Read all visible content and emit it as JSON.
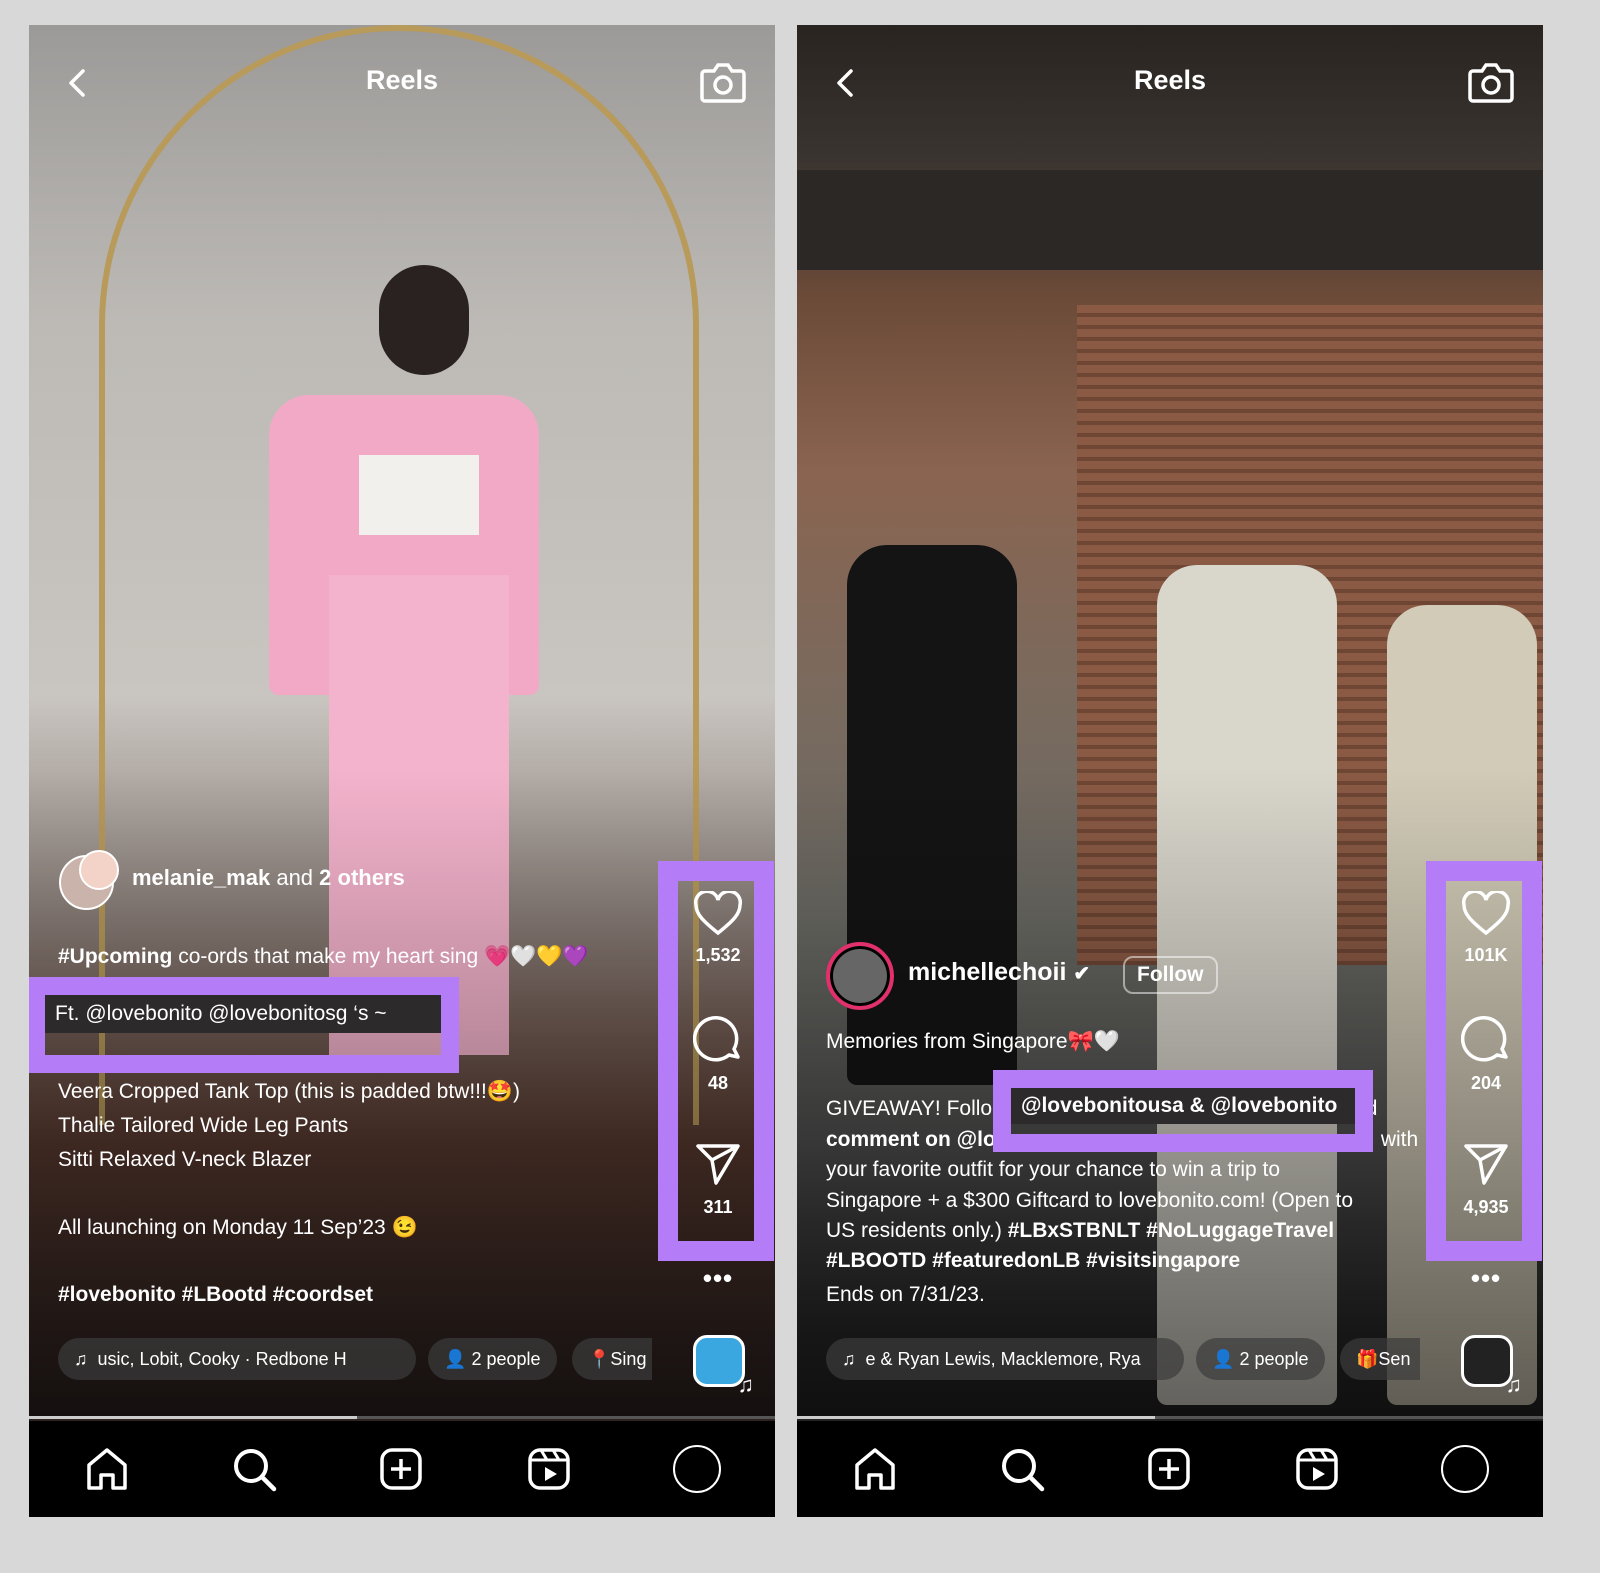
{
  "accent": "#b57cf7",
  "left": {
    "title": "Reels",
    "author": {
      "username": "melanie_mak",
      "and": "and",
      "others": "2 others"
    },
    "caption": {
      "line1_hashtag": "#Upcoming",
      "line1_text": "co-ords that make my heart sing 💗🤍💛💜",
      "highlight": "Ft. @lovebonito @lovebonitosg ‘s ~",
      "line3": "Veera Cropped Tank Top (this is padded btw!!!🤩)",
      "line4": "Thalie Tailored Wide Leg Pants",
      "line5": "Sitti Relaxed V-neck Blazer",
      "line6": "All launching on Monday 11 Sep’23 😉",
      "hashtags": "#lovebonito #LBootd #coordset"
    },
    "likes": "1,532",
    "comments": "48",
    "shares": "311",
    "chips": {
      "audio": "usic, Lobit, Cooky · Redbone   H",
      "people": "2 people",
      "location": "Sing"
    },
    "progress": 0.44
  },
  "right": {
    "title": "Reels",
    "author": {
      "username": "michellechoii",
      "verified": true
    },
    "follow_label": "Follow",
    "caption": {
      "line1": "Memories from Singapore🎀🤍",
      "giveaway_start": "GIVEAWAY! Follo",
      "giveaway_end": "nd",
      "highlight": "@lovebonitousa & @lovebonito",
      "line3_start": "comment on @lo",
      "line3_end": "with",
      "line4": "your favorite outfit for your chance to win a trip to",
      "line5": "Singapore + a $300 Giftcard to lovebonito.com! (Open to",
      "line6_text": "US residents only.)",
      "line6_tags": "#LBxSTBNLT #NoLuggageTravel",
      "line7": "#LBOOTD #featuredonLB #visitsingapore",
      "line8": "Ends on 7/31/23."
    },
    "likes": "101K",
    "comments": "204",
    "shares": "4,935",
    "chips": {
      "audio": "e & Ryan Lewis, Macklemore, Rya",
      "people": "2 people",
      "gift": "Sen"
    },
    "progress": 0.48
  },
  "nav": [
    "home-icon",
    "search-icon",
    "create-icon",
    "reels-icon",
    "profile-icon"
  ]
}
